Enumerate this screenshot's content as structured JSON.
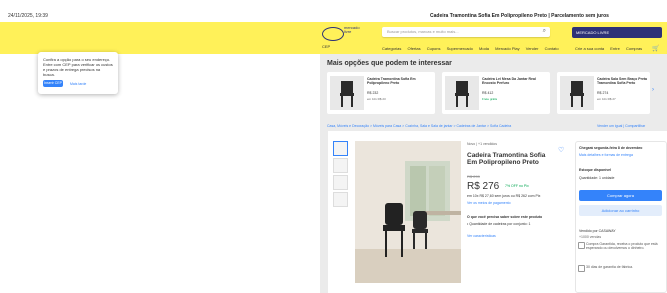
{
  "window": {
    "timestamp": "24/11/2025, 19:39",
    "doc_title": "Cadeira Tramontina Sofia Em Polipropileno Preto | Parcelamento sem juros"
  },
  "header": {
    "logo_text": "mercado livre",
    "search_placeholder": "Buscar produtos, marcas e muito mais...",
    "promo_text": "MERCADO LIVRE",
    "cep": "CEP",
    "nav": [
      "Categorias",
      "Ofertas",
      "Cupons",
      "Supermercado",
      "Moda",
      "Mercado Play",
      "Vender",
      "Contato"
    ],
    "nav_right": [
      "Crie a sua conta",
      "Entre",
      "Compras"
    ]
  },
  "popup": {
    "text": "Confira a opção para o seu endereço. Entre com CEP para verificar os custos e prazos de entrega precisos na busca.",
    "button": "Inserir CEP",
    "link": "Mais tarde"
  },
  "recommendations": {
    "title": "Mais opções que podem te interessar",
    "items": [
      {
        "title": "Cadeira Tramontina Sofia Em Polipropileno Preto",
        "price": "R$ 232",
        "detail": "em 10x R$ 23"
      },
      {
        "title": "Cadeira Lei Mesa Da Jantar Real Encosto Perfuro",
        "price": "R$ 412",
        "detail": "Frete grátis"
      },
      {
        "title": "Cadeira Sala Sem Braço Preta Tramontina Sofia Preto",
        "price": "R$ 274",
        "detail": "em 10x R$ 27"
      }
    ]
  },
  "breadcrumbs": {
    "path": "Casa, Móveis e Decoração  >  Móveis para Casa  >  Cozinha, Sala e Sala de jantar  >  Cadeiras de Jantar  >  Sofia Cadeira",
    "right": "Vender um igual  |  Compartilhar"
  },
  "product": {
    "condition": "Novo | +1 vendidos",
    "title": "Cadeira Tramontina Sofia Em Polipropileno Preto",
    "old_price": "R$ 299",
    "price": "R$ 276",
    "discount": "7% OFF no Pix",
    "installments": "em 10x R$ 27,60 sem juros  ou  R$ 262 com Pix",
    "installments_link": "Ver os meios de pagamento",
    "questions_title": "O que você precisa saber sobre este produto",
    "q1": "• Quantidade de cadeiras por conjunto: 1",
    "q2": "Ver características"
  },
  "buybox": {
    "shipping": "Chegará segunda-feira 8 de dezembro",
    "shipping_link": "Mais detalhes e formas de entrega",
    "stock": "Estoque disponível",
    "quantity": "Quantidade: 1 unidade",
    "buy_button": "Comprar agora",
    "cart_button": "Adicionar ao carrinho",
    "seller": "Vendido por CASAWAY",
    "seller_sub": "+1000 vendas",
    "opt1": "Compra Garantida, receba o produto que está esperando ou devolvemos o dinheiro.",
    "opt2": "30 dias de garantia de fábrica."
  }
}
